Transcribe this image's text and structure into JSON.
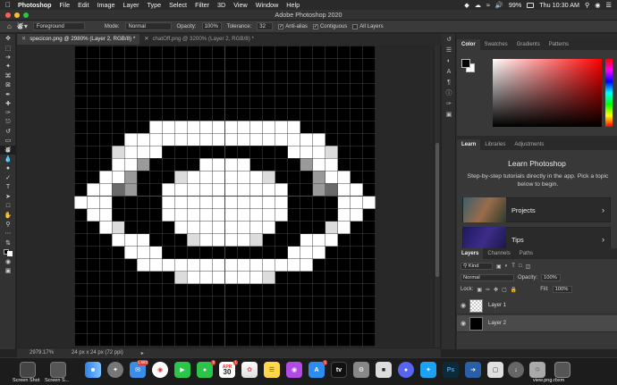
{
  "menubar": {
    "app_name": "Photoshop",
    "menus": [
      "File",
      "Edit",
      "Image",
      "Layer",
      "Type",
      "Select",
      "Filter",
      "3D",
      "View",
      "Window",
      "Help"
    ],
    "battery": "99%",
    "clock": "Thu 10:30 AM"
  },
  "window": {
    "title": "Adobe Photoshop 2020"
  },
  "options_bar": {
    "fill_source": "Foreground",
    "mode_label": "Mode:",
    "mode_value": "Normal",
    "opacity_label": "Opacity:",
    "opacity_value": "100%",
    "tolerance_label": "Tolerance:",
    "tolerance_value": "32",
    "antialias_label": "Anti-alias",
    "contiguous_label": "Contiguous",
    "all_layers_label": "All Layers"
  },
  "tools": [
    "move-icon",
    "marquee-icon",
    "lasso-icon",
    "quick-select-icon",
    "crop-icon",
    "frame-icon",
    "eyedropper-icon",
    "healing-icon",
    "brush-icon",
    "clone-stamp-icon",
    "history-brush-icon",
    "eraser-icon",
    "paint-bucket-icon",
    "blur-icon",
    "dodge-icon",
    "pen-icon",
    "type-icon",
    "path-select-icon",
    "rectangle-icon",
    "hand-icon",
    "zoom-icon",
    "more-tools-icon",
    "edit-toolbar-icon",
    "fg-bg-colors-icon",
    "quick-mask-icon",
    "screen-mode-icon"
  ],
  "tabs": [
    {
      "label": "specicon.png @ 2980% (Layer 2, RGB/8) *",
      "active": true
    },
    {
      "label": "chatOff.png @ 3200% (Layer 2, RGB/8) *",
      "active": false
    }
  ],
  "status": {
    "zoom": "2979.17%",
    "doc_size": "24 px x 24 px (72 ppi)"
  },
  "color_panel": {
    "tabs": [
      "Color",
      "Swatches",
      "Gradients",
      "Patterns"
    ]
  },
  "learn_panel": {
    "tabs": [
      "Learn",
      "Libraries",
      "Adjustments"
    ],
    "title": "Learn Photoshop",
    "description": "Step-by-step tutorials directly in the app. Pick a topic below to begin.",
    "cards": [
      "Projects",
      "Tips"
    ]
  },
  "layers_panel": {
    "tabs": [
      "Layers",
      "Channels",
      "Paths"
    ],
    "kind_label": "Kind",
    "blend_mode": "Normal",
    "opacity_label": "Opacity:",
    "opacity_value": "100%",
    "lock_label": "Lock:",
    "fill_label": "Fill:",
    "fill_value": "100%",
    "layers": [
      "Layer 1",
      "Layer 2"
    ]
  },
  "dock": {
    "labels": [
      "Screen Shot",
      "Screen S...",
      "view.png.rbxm"
    ],
    "badge_mail": "1,663",
    "badge_messages": "2",
    "badge_calendar": "1",
    "badge_appstore": "1",
    "calendar_date": "30",
    "calendar_month": "APR"
  },
  "pixel_art": {
    "palette": {
      "0": "#000000",
      "1": "#ffffff",
      "2": "#dcdcdc",
      "3": "#9a9a9a",
      "4": "#6a6a6a"
    },
    "rows": [
      "000000000000000000000000",
      "000000000000000000000000",
      "000000000000000000000000",
      "000000000000000000000000",
      "000000000000000000000000",
      "000000000000000000000000",
      "000000111111111111000000",
      "000011111111111111110000",
      "000211100000000001112000",
      "000113000011110000311000",
      "001130002111111200031100",
      "011430011111111110034110",
      "111000011111111110000111",
      "011000011111111110000110",
      "001200001111111100002100",
      "000111000211112000111000",
      "000011100000000001110000",
      "000001111111111111100000",
      "000000002111111200000000",
      "000000000000000000000000",
      "000000000000000000000000",
      "000000000000000000000000",
      "000000000000000000000000",
      "000000000000000000000000"
    ]
  }
}
